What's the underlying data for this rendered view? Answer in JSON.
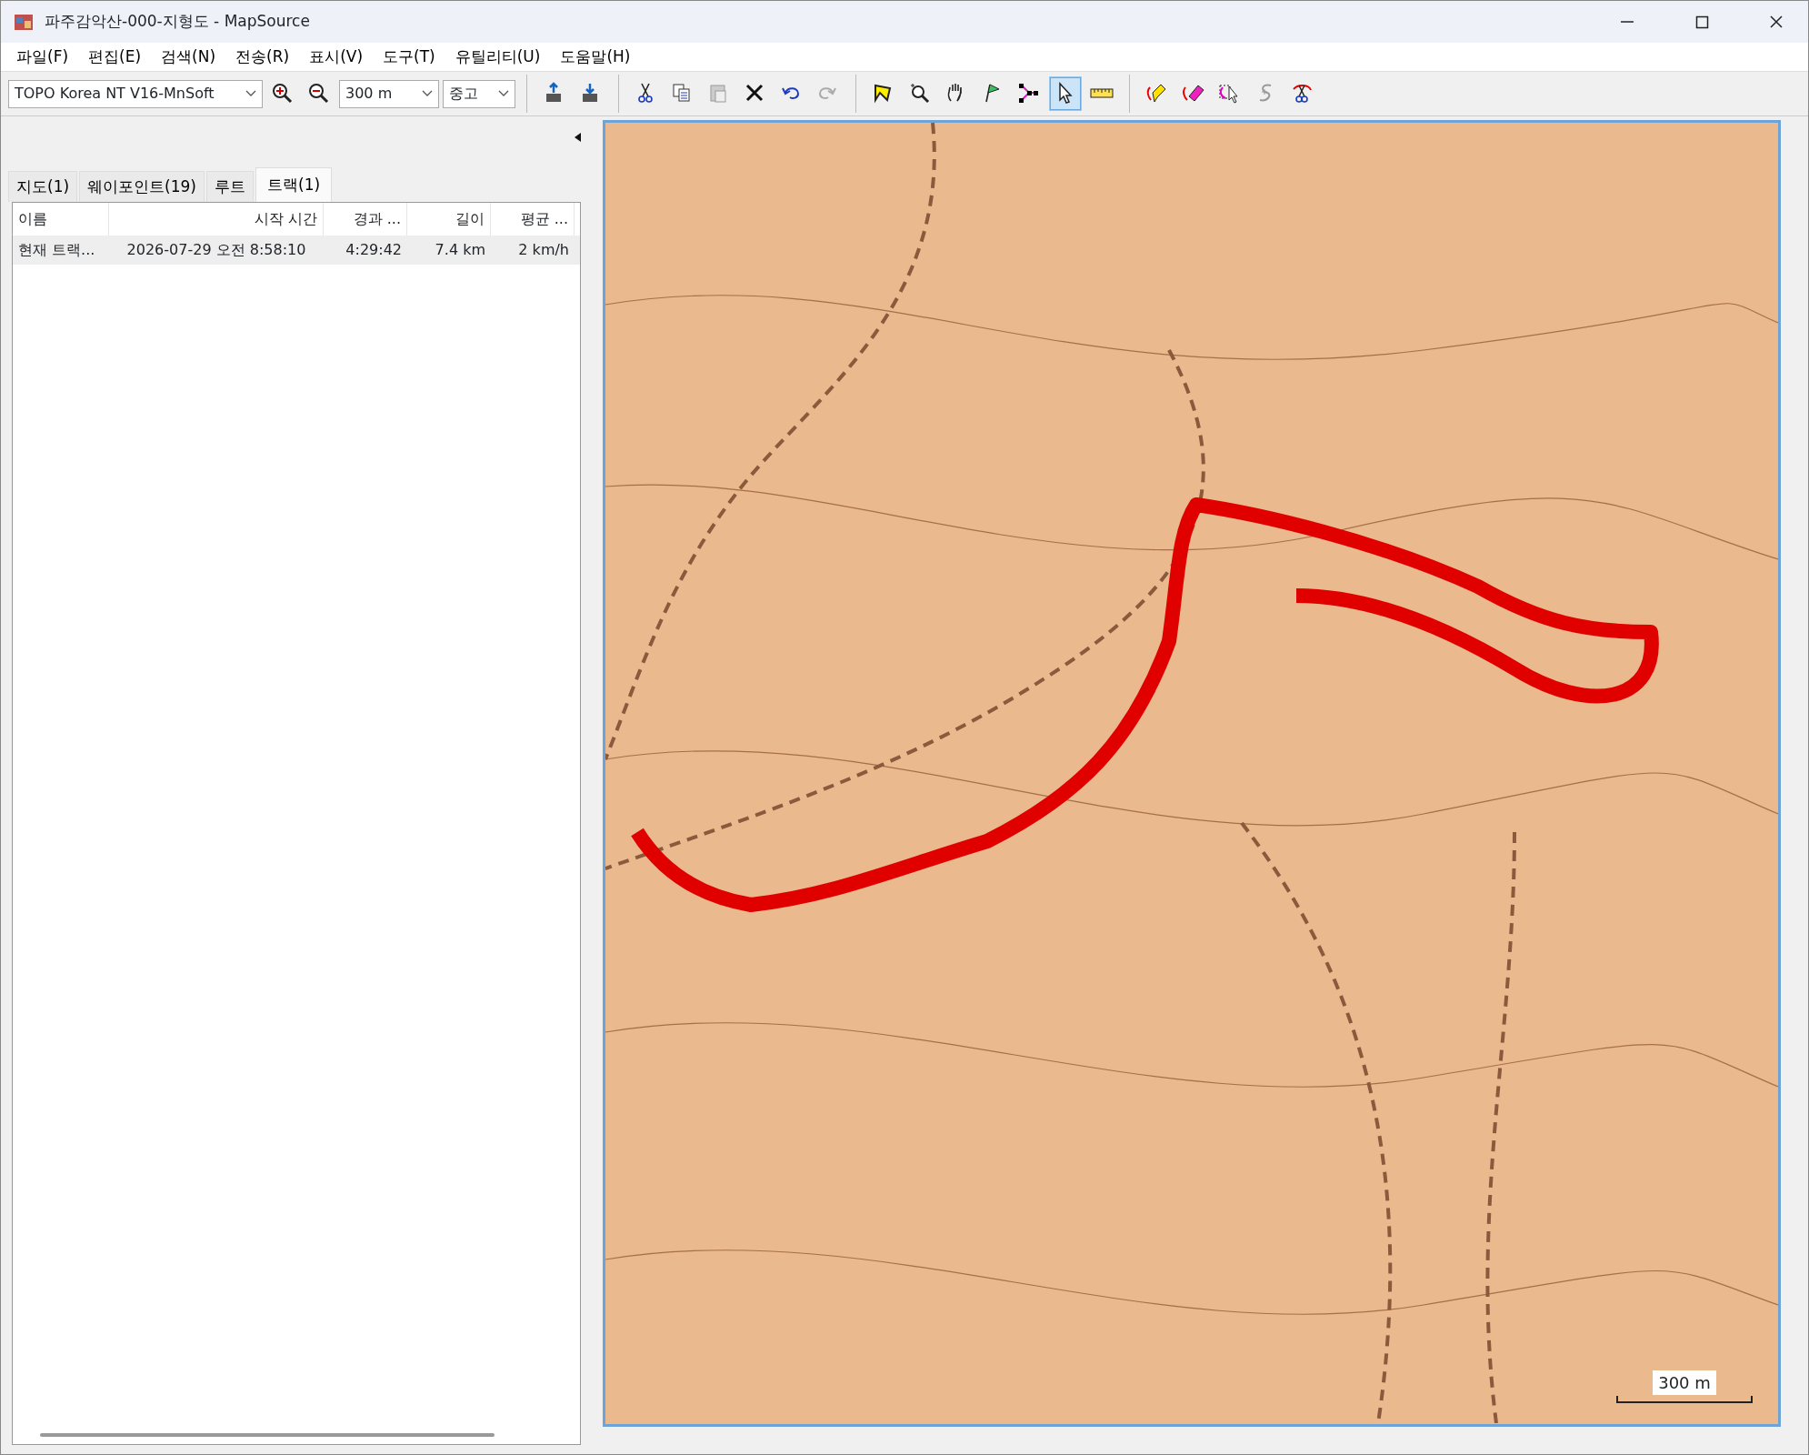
{
  "window": {
    "title": "파주감악산-000-지형도 - MapSource"
  },
  "menu": [
    "파일(F)",
    "편집(E)",
    "검색(N)",
    "전송(R)",
    "표시(V)",
    "도구(T)",
    "유틸리티(U)",
    "도움말(H)"
  ],
  "toolbar": {
    "map_product": "TOPO Korea NT V16-MnSoft",
    "zoom_scale": "300 m",
    "detail": "중고",
    "tools": [
      {
        "kind": "zoomin",
        "selected": false
      },
      {
        "kind": "zoomout",
        "selected": false
      },
      {
        "kind": "sep"
      },
      {
        "kind": "receive",
        "selected": false
      },
      {
        "kind": "send",
        "selected": false
      },
      {
        "kind": "sep"
      },
      {
        "kind": "cut",
        "selected": false
      },
      {
        "kind": "copy",
        "selected": false
      },
      {
        "kind": "paste",
        "selected": false
      },
      {
        "kind": "delete",
        "selected": false
      },
      {
        "kind": "undo",
        "selected": false
      },
      {
        "kind": "redo",
        "selected": false
      },
      {
        "kind": "sep"
      },
      {
        "kind": "map",
        "selected": false
      },
      {
        "kind": "zoom",
        "selected": false
      },
      {
        "kind": "hand",
        "selected": false
      },
      {
        "kind": "flag",
        "selected": false
      },
      {
        "kind": "route",
        "selected": false
      },
      {
        "kind": "pointer",
        "selected": true
      },
      {
        "kind": "ruler",
        "selected": false
      },
      {
        "kind": "sep"
      },
      {
        "kind": "pencil",
        "selected": false
      },
      {
        "kind": "eraser",
        "selected": false
      },
      {
        "kind": "select",
        "selected": false
      },
      {
        "kind": "join",
        "selected": false
      },
      {
        "kind": "scissors",
        "selected": false
      }
    ]
  },
  "tabs": [
    {
      "label": "지도(1)",
      "selected": false
    },
    {
      "label": "웨이포인트(19)",
      "selected": false
    },
    {
      "label": "루트",
      "selected": false
    },
    {
      "label": "트랙(1)",
      "selected": true
    }
  ],
  "table": {
    "columns": [
      "이름",
      "시작 시간",
      "경과 ...",
      "길이",
      "평균 ..."
    ],
    "rows": [
      [
        "현재 트랙...",
        "2026-07-29 오전 8:58:10",
        "4:29:42",
        "7.4 km",
        "2 km/h"
      ]
    ]
  },
  "map": {
    "scale_label": "300 m"
  }
}
